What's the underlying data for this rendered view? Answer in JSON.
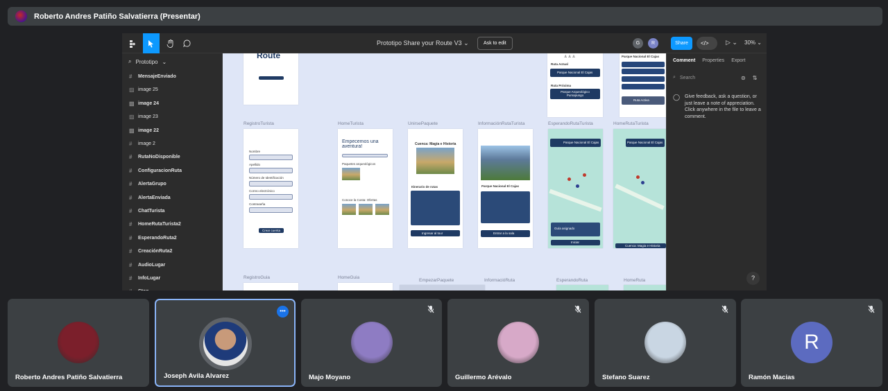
{
  "presenter": {
    "title": "Roberto Andres Patiño Salvatierra (Presentar)"
  },
  "figma": {
    "doc_title": "Prototipo Share your Route V3",
    "ask_to_edit": "Ask to edit",
    "avatar_g": "G",
    "avatar_r": "R",
    "share_label": "Share",
    "code_label": "</>",
    "zoom": "30%",
    "page_name": "Prototipo",
    "layers": [
      {
        "label": "MensajeEnviado",
        "icon": "frame-icon"
      },
      {
        "label": "image 25",
        "icon": "image-icon"
      },
      {
        "label": "image 24",
        "icon": "image-icon"
      },
      {
        "label": "image 23",
        "icon": "image-icon"
      },
      {
        "label": "image 22",
        "icon": "image-icon"
      },
      {
        "label": "image 2",
        "icon": "frame-icon"
      },
      {
        "label": "RutaNoDisponible",
        "icon": "frame-icon"
      },
      {
        "label": "ConfiguracionRuta",
        "icon": "frame-icon"
      },
      {
        "label": "AlertaGrupo",
        "icon": "frame-icon"
      },
      {
        "label": "AlertaEnviada",
        "icon": "frame-icon"
      },
      {
        "label": "ChatTurista",
        "icon": "frame-icon"
      },
      {
        "label": "HomeRutaTurista2",
        "icon": "frame-icon"
      },
      {
        "label": "EsperandoRuta2",
        "icon": "frame-icon"
      },
      {
        "label": "CreaciónRuta2",
        "icon": "frame-icon"
      },
      {
        "label": "AudioLugar",
        "icon": "frame-icon"
      },
      {
        "label": "InfoLugar",
        "icon": "frame-icon"
      },
      {
        "label": "Stop",
        "icon": "frame-icon"
      }
    ],
    "canvas": {
      "frame_labels": [
        "RegistroTurista",
        "HomeTurista",
        "UnirsePaquete",
        "InformaciónRutaTurista",
        "EsperandoRutaTurista",
        "HomeRutaTurista",
        "RegistroGuia",
        "HomeGuia",
        "EmpezarPaquete",
        "InformacióRuta",
        "EsperandoRuta",
        "HomeRuta"
      ],
      "logo": "Route",
      "register_fields": [
        "Nombre",
        "Apellido",
        "Número de Identificación",
        "Correo electrónico",
        "Contraseña"
      ],
      "register_button": "Crear cuenta",
      "home_heading": "Empecemos una aventura!",
      "home_sections": [
        "Paquetes arqueológicos",
        "Conoce la Costa: Ofertas"
      ],
      "package_title": "Cuenca: Magia e Historia",
      "package_subtitle": "Itinerario de rutas",
      "package_button": "Ingresar al tour",
      "park_title": "Parque Nacional El Cajas",
      "park_button": "Entrar a la sala",
      "route_start_button": "Iniciar",
      "route_group_label": "Guía asignado",
      "route_banner": "Cuenca: Magia e Historia",
      "ruta_actual": "Ruta Actual",
      "ruta_proxima": "Ruta Próxima",
      "ruta_actual_value": "Parque Nacional El Cajas",
      "ruta_proxima_value": "Parque Arqueológico Pumapungo",
      "ruta_activa": "Ruta Activa"
    },
    "right_tabs": [
      "Comment",
      "Properties",
      "Export"
    ],
    "search_placeholder": "Search",
    "feedback_text": "Give feedback, ask a question, or just leave a note of appreciation. Click anywhere in the file to leave a comment.",
    "help": "?"
  },
  "participants": [
    {
      "name": "Roberto Andres Patiño Salvatierra",
      "muted": false,
      "active": false,
      "avatar_color": "#7b1f2b"
    },
    {
      "name": "Joseph Avila Alvarez",
      "muted": false,
      "active": true,
      "avatar_color": "#5f6368"
    },
    {
      "name": "Majo Moyano",
      "muted": true,
      "active": false,
      "avatar_color": "#8e7cc3"
    },
    {
      "name": "Guillermo Arévalo",
      "muted": true,
      "active": false,
      "avatar_color": "#d7a9c8"
    },
    {
      "name": "Stefano Suarez",
      "muted": true,
      "active": false,
      "avatar_color": "#c9d6e3"
    },
    {
      "name": "Ramón Macias",
      "muted": true,
      "active": false,
      "avatar_color": "#5c6bc0",
      "initial": "R"
    }
  ],
  "colors": {
    "accent": "#0d99ff",
    "meet_bg": "#202124",
    "tile_bg": "#3c4043",
    "active_border": "#8ab4f8"
  }
}
